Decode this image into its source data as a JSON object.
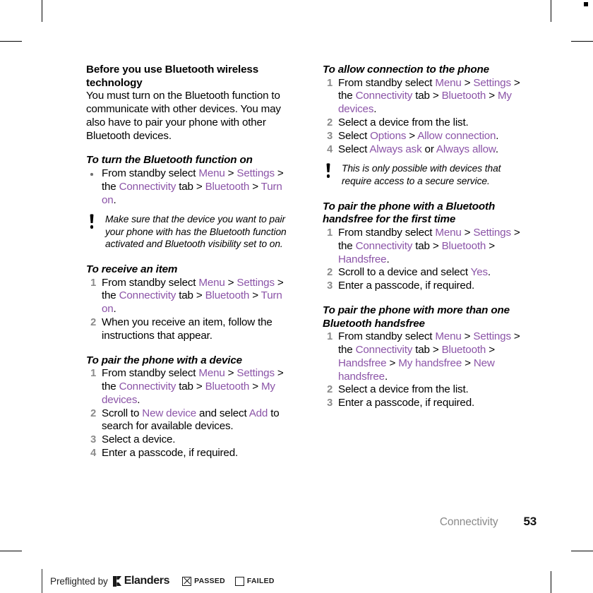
{
  "document": {
    "chapter_footer": "Connectivity",
    "page_number": "53"
  },
  "left_column": {
    "intro_heading": "Before you use Bluetooth wireless technology",
    "intro_paragraph": "You must turn on the Bluetooth function to communicate with other devices. You may also have to pair your phone with other Bluetooth devices.",
    "section_turn_on": {
      "heading": "To turn the Bluetooth function on",
      "bullet": {
        "t1": "From standby select ",
        "ui1": "Menu",
        "t2": " > ",
        "ui2": "Settings",
        "t3": " > the ",
        "ui3": "Connectivity",
        "t4": " tab > ",
        "ui4": "Bluetooth",
        "t5": " > ",
        "ui5": "Turn on",
        "t6": "."
      }
    },
    "note": "Make sure that the device you want to pair your phone with has the Bluetooth function activated and Bluetooth visibility set to on.",
    "section_receive": {
      "heading": "To receive an item",
      "step1": {
        "t1": "From standby select ",
        "ui1": "Menu",
        "t2": " > ",
        "ui2": "Settings",
        "t3": " > the ",
        "ui3": "Connectivity",
        "t4": " tab > ",
        "ui4": "Bluetooth",
        "t5": " > ",
        "ui5": "Turn on",
        "t6": "."
      },
      "step2": "When you receive an item, follow the instructions that appear."
    },
    "section_pair_device": {
      "heading": "To pair the phone with a device",
      "step1": {
        "t1": "From standby select ",
        "ui1": "Menu",
        "t2": " > ",
        "ui2": "Settings",
        "t3": " > the ",
        "ui3": "Connectivity",
        "t4": " tab > ",
        "ui4": "Bluetooth",
        "t5": " > ",
        "ui5": "My devices",
        "t6": "."
      },
      "step2": {
        "t1": "Scroll to ",
        "ui1": "New device",
        "t2": " and select ",
        "ui2": "Add",
        "t3": " to search for available devices."
      },
      "step3": "Select a device.",
      "step4": "Enter a passcode, if required."
    }
  },
  "right_column": {
    "section_allow": {
      "heading": "To allow connection to the phone",
      "step1": {
        "t1": "From standby select ",
        "ui1": "Menu",
        "t2": " > ",
        "ui2": "Settings",
        "t3": " > the ",
        "ui3": "Connectivity",
        "t4": " tab > ",
        "ui4": "Bluetooth",
        "t5": " > ",
        "ui5": "My devices",
        "t6": "."
      },
      "step2": "Select a device from the list.",
      "step3": {
        "t1": "Select ",
        "ui1": "Options",
        "t2": " > ",
        "ui2": "Allow connection",
        "t3": "."
      },
      "step4": {
        "t1": "Select ",
        "ui1": "Always ask",
        "t2": " or ",
        "ui2": "Always allow",
        "t3": "."
      }
    },
    "note": "This is only possible with devices that require access to a secure service.",
    "section_handsfree_first": {
      "heading": "To pair the phone with a Bluetooth handsfree for the first time",
      "step1": {
        "t1": "From standby select ",
        "ui1": "Menu",
        "t2": " > ",
        "ui2": "Settings",
        "t3": " > the ",
        "ui3": "Connectivity",
        "t4": " tab > ",
        "ui4": "Bluetooth",
        "t5": " > ",
        "ui5": "Handsfree",
        "t6": "."
      },
      "step2": {
        "t1": "Scroll to a device and select ",
        "ui1": "Yes",
        "t2": "."
      },
      "step3": "Enter a passcode, if required."
    },
    "section_handsfree_more": {
      "heading": "To pair the phone with more than one Bluetooth handsfree",
      "step1": {
        "t1": "From standby select ",
        "ui1": "Menu",
        "t2": " > ",
        "ui2": "Settings",
        "t3": " > the ",
        "ui3": "Connectivity",
        "t4": " tab > ",
        "ui4": "Bluetooth",
        "t5": " > ",
        "ui5": "Handsfree",
        "t6": " > ",
        "ui6": "My handsfree",
        "t7": " > ",
        "ui7": "New handsfree",
        "t8": "."
      },
      "step2": "Select a device from the list.",
      "step3": "Enter a passcode, if required."
    }
  },
  "preflight": {
    "prefix": "Preflighted by",
    "brand": "Elanders",
    "passed_label": "PASSED",
    "failed_label": "FAILED"
  },
  "colors": {
    "ui_path_purple": "#8c55a8",
    "step_number_gray": "#8a8a8a",
    "footer_gray": "#8a8a8a",
    "text_black": "#000000"
  }
}
